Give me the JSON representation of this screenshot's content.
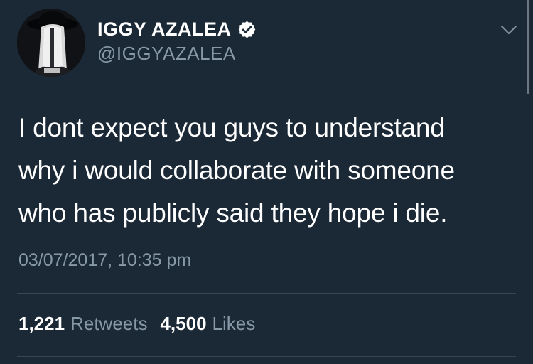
{
  "tweet": {
    "author": {
      "display_name": "IGGY AZALEA",
      "handle": "@IGGYAZALEA",
      "verified": true,
      "verified_icon": "verified-badge-icon"
    },
    "menu_icon": "chevron-down-icon",
    "text_lines": [
      "I dont expect you guys to understand",
      "why i would collaborate with someone",
      "who has publicly said they hope i die."
    ],
    "timestamp": "03/07/2017, 10:35 pm",
    "stats": {
      "retweets_count": "1,221",
      "retweets_label": "Retweets",
      "likes_count": "4,500",
      "likes_label": "Likes"
    }
  },
  "colors": {
    "background": "#1b2836",
    "primary_text": "#ffffff",
    "secondary_text": "#8899a6",
    "divider": "#3a4553"
  }
}
